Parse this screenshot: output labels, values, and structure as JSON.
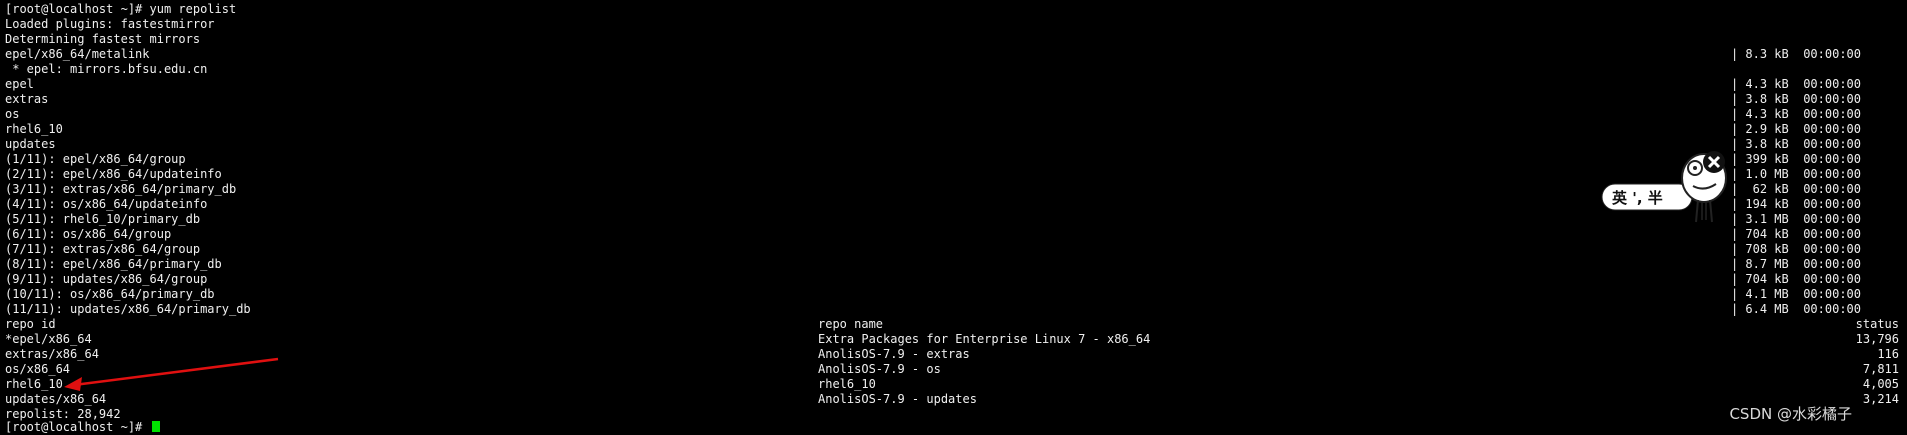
{
  "terminal": {
    "prompt_command": "[root@localhost ~]# yum repolist",
    "lines": [
      "Loaded plugins: fastestmirror",
      "Determining fastest mirrors",
      "epel/x86_64/metalink",
      " * epel: mirrors.bfsu.edu.cn",
      "epel",
      "extras",
      "os",
      "rhel6_10",
      "updates",
      "(1/11): epel/x86_64/group",
      "(2/11): epel/x86_64/updateinfo",
      "(3/11): extras/x86_64/primary_db",
      "(4/11): os/x86_64/updateinfo",
      "(5/11): rhel6_10/primary_db",
      "(6/11): os/x86_64/group",
      "(7/11): extras/x86_64/group",
      "(8/11): epel/x86_64/primary_db",
      "(9/11): updates/x86_64/group",
      "(10/11): os/x86_64/primary_db",
      "(11/11): updates/x86_64/primary_db"
    ],
    "right_column": [
      "| 8.3 kB  00:00:00",
      "| 4.3 kB  00:00:00",
      "| 3.8 kB  00:00:00",
      "| 4.3 kB  00:00:00",
      "| 2.9 kB  00:00:00",
      "| 3.8 kB  00:00:00",
      "| 399 kB  00:00:00",
      "| 1.0 MB  00:00:00",
      "|  62 kB  00:00:00",
      "| 194 kB  00:00:00",
      "| 3.1 MB  00:00:00",
      "| 704 kB  00:00:00",
      "| 708 kB  00:00:00",
      "| 8.7 MB  00:00:00",
      "| 704 kB  00:00:00",
      "| 4.1 MB  00:00:00",
      "| 6.4 MB  00:00:00"
    ],
    "table": {
      "headers": {
        "repo_id": "repo id",
        "repo_name": "repo name",
        "status": "status"
      },
      "rows": [
        {
          "id": "*epel/x86_64",
          "name": "Extra Packages for Enterprise Linux 7 - x86_64",
          "status": "13,796"
        },
        {
          "id": "extras/x86_64",
          "name": "AnolisOS-7.9 - extras",
          "status": "116"
        },
        {
          "id": "os/x86_64",
          "name": "AnolisOS-7.9 - os",
          "status": "7,811"
        },
        {
          "id": "rhel6_10",
          "name": "rhel6_10",
          "status": "4,005"
        },
        {
          "id": "updates/x86_64",
          "name": "AnolisOS-7.9 - updates",
          "status": "3,214"
        }
      ]
    },
    "repolist_summary": "repolist: 28,942",
    "final_prompt": "[root@localhost ~]# "
  },
  "sticker": {
    "text": "英 ', 半"
  },
  "watermark": "CSDN @水彩橘子",
  "colors": {
    "background": "#000000",
    "text": "#f0f0f0",
    "cursor": "#00e000",
    "arrow": "#e01010"
  }
}
